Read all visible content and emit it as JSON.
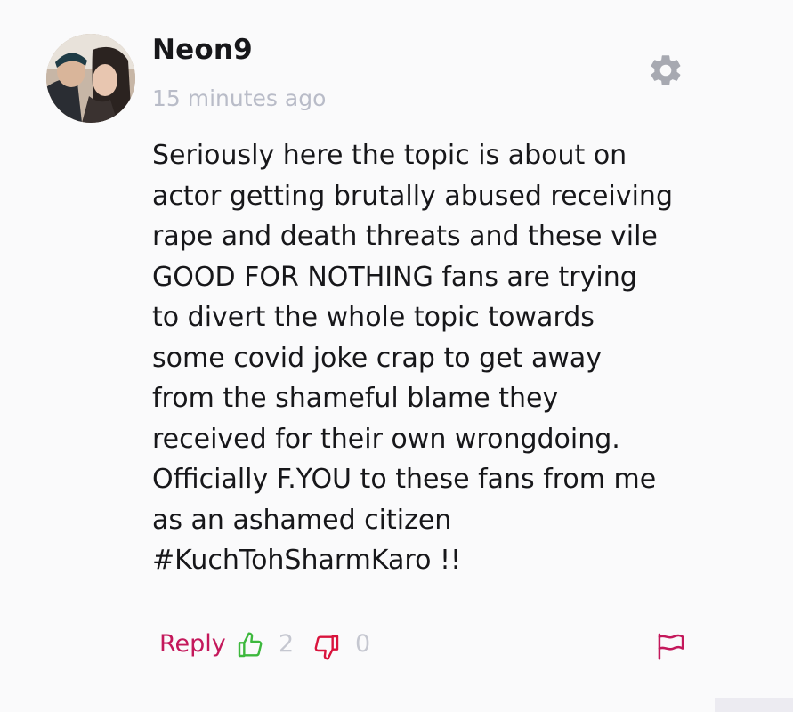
{
  "comment": {
    "author": "Neon9",
    "timestamp": "15 minutes ago",
    "avatar_icon": "user-avatar-photo",
    "body_lines": [
      "Seriously here the topic is about on",
      "actor getting brutally abused receiving",
      "rape and death threats and these vile",
      "GOOD FOR NOTHING fans are trying",
      "to divert the whole topic towards",
      "some covid joke crap to get away",
      "from the shameful blame they",
      "received for their own wrongdoing.",
      "Officially F.YOU to these fans from me",
      "as an ashamed citizen",
      "#KuchTohSharmKaro !!"
    ],
    "actions": {
      "reply_label": "Reply",
      "like_count": "2",
      "dislike_count": "0",
      "like_icon": "thumbs-up-icon",
      "dislike_icon": "thumbs-down-icon",
      "flag_icon": "flag-icon",
      "settings_icon": "gear-icon"
    }
  },
  "colors": {
    "background": "#fafafb",
    "text": "#17171a",
    "muted": "#b9bcc8",
    "accent": "#c4185b",
    "like": "#3db83d",
    "dislike": "#d9143d",
    "gear": "#a7a9b1"
  }
}
